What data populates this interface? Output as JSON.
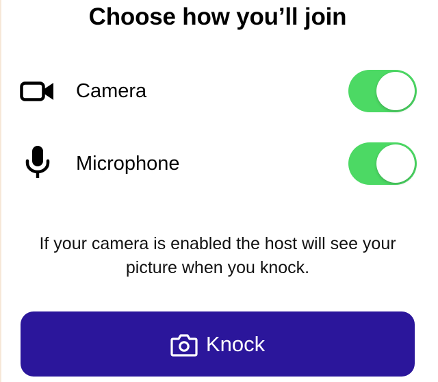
{
  "title": "Choose how you’ll join",
  "options": [
    {
      "icon": "video-camera-icon",
      "label": "Camera",
      "enabled": true
    },
    {
      "icon": "microphone-icon",
      "label": "Microphone",
      "enabled": true
    }
  ],
  "info_text": "If your camera is enabled the host will see your picture when you knock.",
  "knock_button": {
    "icon": "camera-icon",
    "label": "Knock"
  },
  "colors": {
    "toggle_on": "#4cd964",
    "button_bg": "#2b169b",
    "button_text": "#ffffff"
  }
}
